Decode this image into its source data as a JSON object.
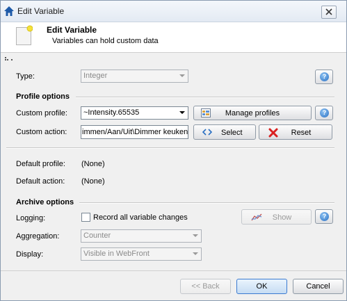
{
  "window": {
    "title": "Edit Variable"
  },
  "header": {
    "title": "Edit Variable",
    "subtitle": "Variables can hold custom data"
  },
  "type_row": {
    "label": "Type:",
    "value": "Integer"
  },
  "profile_options": {
    "title": "Profile options",
    "custom_profile_label": "Custom profile:",
    "custom_profile_value": "~Intensity.65535",
    "manage_profiles_label": "Manage profiles",
    "custom_action_label": "Custom action:",
    "custom_action_value": "immen/Aan/Uit\\Dimmer keuken",
    "select_label": "Select",
    "reset_label": "Reset",
    "default_profile_label": "Default profile:",
    "default_profile_value": "(None)",
    "default_action_label": "Default action:",
    "default_action_value": "(None)"
  },
  "archive_options": {
    "title": "Archive options",
    "logging_label": "Logging:",
    "logging_checkbox_label": "Record all variable changes",
    "logging_checked": false,
    "show_label": "Show",
    "aggregation_label": "Aggregation:",
    "aggregation_value": "Counter",
    "display_label": "Display:",
    "display_value": "Visible in WebFront"
  },
  "footer": {
    "back_label": "<< Back",
    "ok_label": "OK",
    "cancel_label": "Cancel"
  },
  "icons": {
    "title": "home-icon",
    "close": "close-icon",
    "header": "variable-doc-icon",
    "help": "help-icon",
    "manage": "profile-list-icon",
    "select": "code-brackets-icon",
    "reset": "red-x-icon",
    "show": "chart-line-icon"
  },
  "colors": {
    "accent": "#3a7ad1",
    "reset_icon": "#d92020",
    "title_icon": "#1e5aa8"
  }
}
